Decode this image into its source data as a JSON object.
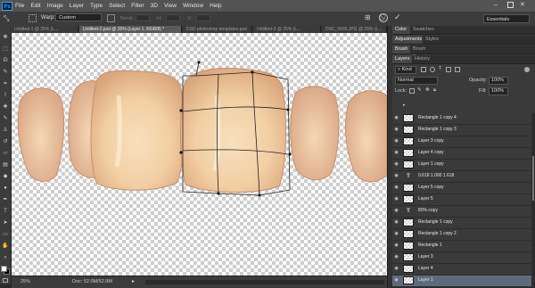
{
  "app": {
    "logo": "Ps"
  },
  "menu": [
    "File",
    "Edit",
    "Image",
    "Layer",
    "Type",
    "Select",
    "Filter",
    "3D",
    "View",
    "Window",
    "Help"
  ],
  "options": {
    "warp_label": "Warp:",
    "warp_value": "Custom",
    "dim_fields": [
      "",
      "Bend:",
      "H:",
      "V:"
    ],
    "workspace": "Essentials",
    "cancel_icon": "cancel-icon",
    "commit_icon": "check-icon"
  },
  "tabs": [
    "Untitled-1 @ 25% (L...",
    "Untitled-2.psd @ 25% (Layer 1, RGB/8) *",
    "DSD photoshop templates.psd",
    "Untitled-3 @ 25% (L...",
    "DSC_0435.JPG @ 25% (L..."
  ],
  "status": {
    "zoom": "25%",
    "doc": "Doc: 52.0M/52.9M"
  },
  "panels": {
    "color_tabs": [
      "Color",
      "Swatches"
    ],
    "adjust_tabs": [
      "Adjustments",
      "Styles"
    ],
    "brush_tabs": [
      "Brush",
      "Brush Presets"
    ],
    "layers_tabs": [
      "Layers",
      "History"
    ],
    "kind_label": "Kind",
    "blend_mode": "Normal",
    "opacity_label": "Opacity:",
    "opacity_value": "100%",
    "lock_label": "Lock:",
    "fill_label": "Fill:",
    "fill_value": "100%"
  },
  "layers": [
    {
      "name": "Rectangle 1 copy 4",
      "type": "pixel",
      "selected": false
    },
    {
      "name": "Rectangle 1 copy 3",
      "type": "pixel",
      "selected": false
    },
    {
      "name": "Layer 3 copy",
      "type": "pixel",
      "selected": false
    },
    {
      "name": "Layer 4 copy",
      "type": "pixel",
      "selected": false
    },
    {
      "name": "Layer 1 copy",
      "type": "pixel",
      "selected": false
    },
    {
      "name": "0.618          1.000          1.618",
      "type": "text",
      "selected": false
    },
    {
      "name": "Layer 5 copy",
      "type": "pixel",
      "selected": false
    },
    {
      "name": "Layer 5",
      "type": "pixel",
      "selected": false
    },
    {
      "name": "80% copy",
      "type": "text",
      "selected": false
    },
    {
      "name": "Rectangle 1 copy",
      "type": "pixel",
      "selected": false
    },
    {
      "name": "Rectangle 1 copy 2",
      "type": "pixel",
      "selected": false
    },
    {
      "name": "Rectangle 1",
      "type": "pixel",
      "selected": false
    },
    {
      "name": "Layer 3",
      "type": "pixel",
      "selected": false
    },
    {
      "name": "Layer 4",
      "type": "pixel",
      "selected": false
    },
    {
      "name": "Layer 1",
      "type": "pixel",
      "selected": true
    }
  ],
  "colors": {
    "foreground": "#ffffff",
    "background": "#000000",
    "accent": "#31a8ff"
  }
}
